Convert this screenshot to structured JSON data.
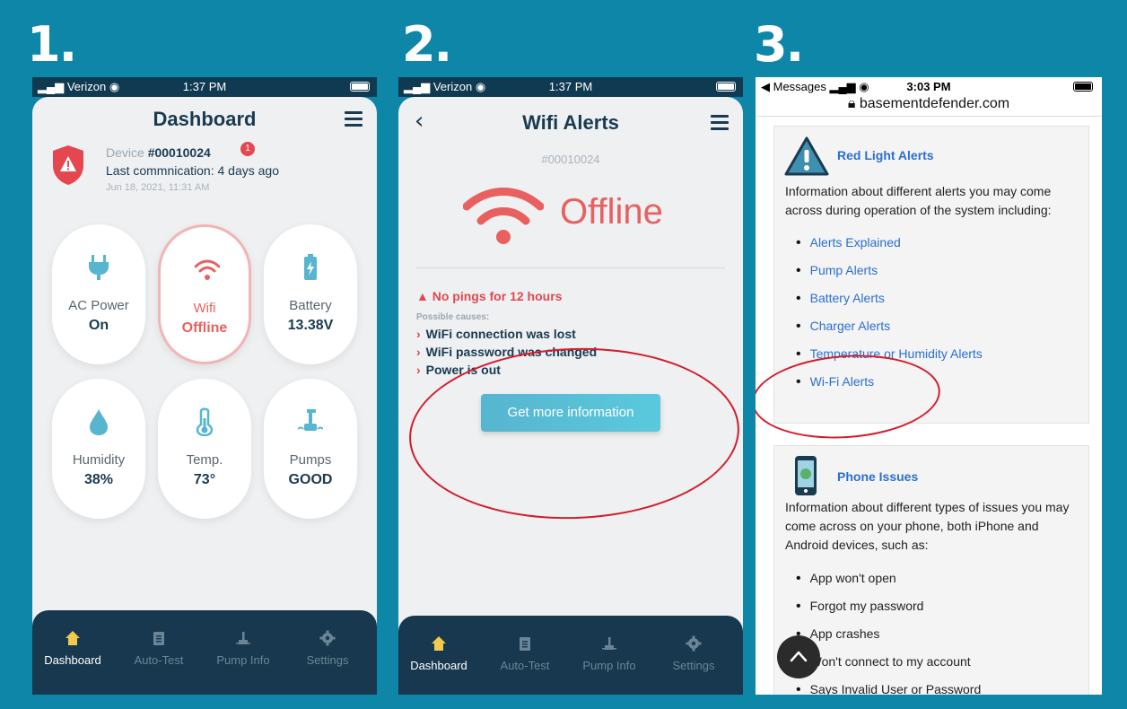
{
  "steps": [
    "1.",
    "2.",
    "3."
  ],
  "phone1": {
    "status": {
      "carrier": "Verizon",
      "time": "1:37 PM"
    },
    "title": "Dashboard",
    "device": {
      "prefix": "Device",
      "id": "#00010024",
      "badge": "1",
      "last_comm": "Last commnication: 4 days ago",
      "date": "Jun 18, 2021, 11:31 AM"
    },
    "tiles": [
      {
        "label": "AC Power",
        "value": "On",
        "icon": "plug-icon"
      },
      {
        "label": "Wifi",
        "value": "Offline",
        "icon": "wifi-icon"
      },
      {
        "label": "Battery",
        "value": "13.38V",
        "icon": "battery-icon"
      },
      {
        "label": "Humidity",
        "value": "38%",
        "icon": "droplet-icon"
      },
      {
        "label": "Temp.",
        "value": "73°",
        "icon": "thermometer-icon"
      },
      {
        "label": "Pumps",
        "value": "GOOD",
        "icon": "pump-icon"
      }
    ],
    "tabs": [
      "Dashboard",
      "Auto-Test",
      "Pump Info",
      "Settings"
    ]
  },
  "phone2": {
    "status": {
      "carrier": "Verizon",
      "time": "1:37 PM"
    },
    "title": "Wifi Alerts",
    "device_id": "#00010024",
    "state": "Offline",
    "ping_alert": "No pings for 12 hours",
    "causes_heading": "Possible causes:",
    "causes": [
      "WiFi connection was lost",
      "WiFi password was changed",
      "Power is out"
    ],
    "button": "Get more information",
    "tabs": [
      "Dashboard",
      "Auto-Test",
      "Pump Info",
      "Settings"
    ]
  },
  "phone3": {
    "status": {
      "back": "◀ Messages",
      "time": "3:03 PM",
      "url": "basementdefender.com"
    },
    "card1": {
      "heading": "Red Light Alerts",
      "desc": "Information about different alerts you may come across during operation of the system including:",
      "links": [
        "Alerts Explained",
        "Pump Alerts",
        "Battery Alerts",
        "Charger Alerts",
        "Temperature or Humidity Alerts",
        "Wi-Fi Alerts"
      ]
    },
    "card2": {
      "heading": "Phone Issues",
      "desc": "Information about different types of issues you may come across on your phone, both iPhone and Android devices, such as:",
      "items": [
        "App won't open",
        "Forgot my password",
        "App crashes",
        "Won't connect to my account",
        "Says Invalid User or Password"
      ]
    }
  },
  "colors": {
    "background": "#0e86a8",
    "navy": "#17384e",
    "alert_red": "#e96060",
    "annotation_red": "#d41c2c",
    "link_blue": "#2a6fd1",
    "button_teal": "#57b5cf"
  }
}
